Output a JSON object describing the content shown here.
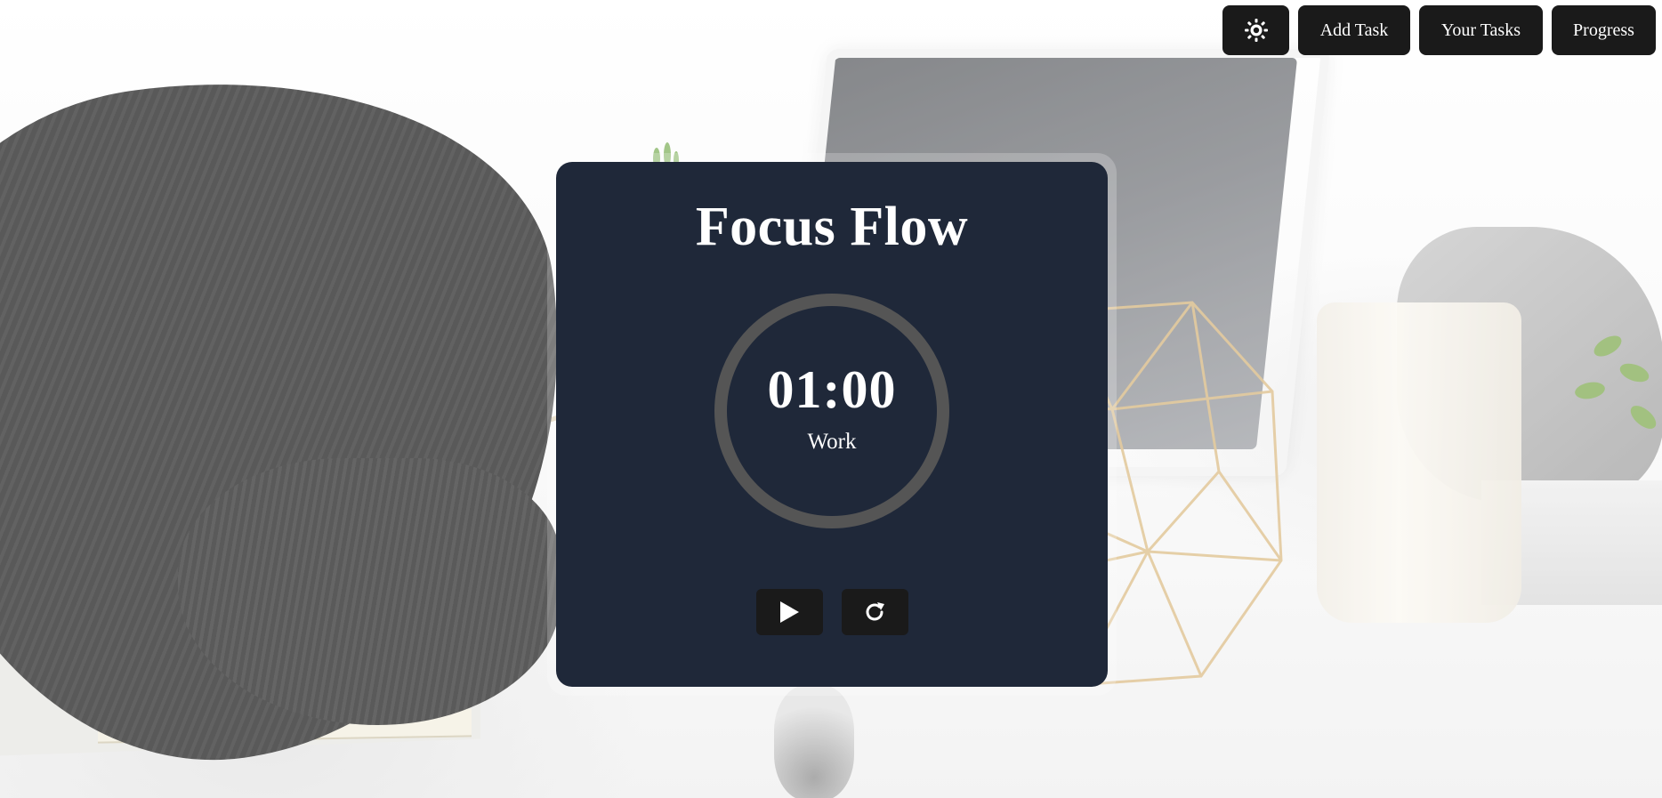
{
  "nav": {
    "theme_icon": "sun-icon",
    "add_task_label": "Add Task",
    "your_tasks_label": "Your Tasks",
    "progress_label": "Progress"
  },
  "timer": {
    "title": "Focus Flow",
    "time": "01:00",
    "mode": "Work",
    "progress": 0,
    "play_icon": "play-icon",
    "reset_icon": "reset-icon"
  },
  "colors": {
    "card_background": "#1f2839",
    "button_background": "#1a1a1a",
    "ring_track": "#555555",
    "text": "#ffffff"
  }
}
